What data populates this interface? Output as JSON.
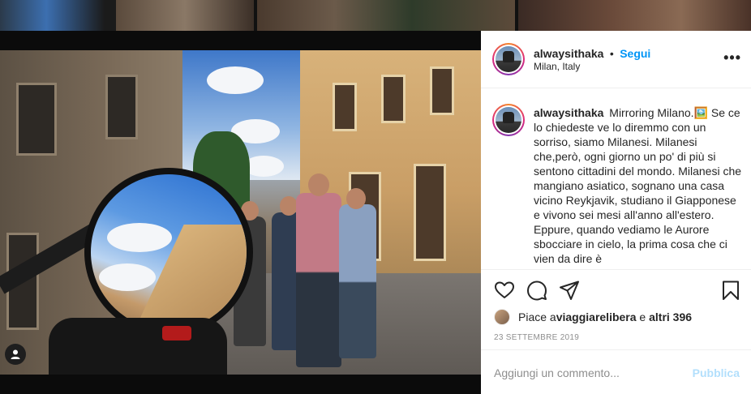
{
  "post": {
    "username": "alwaysithaka",
    "separator": "•",
    "follow_label": "Segui",
    "location": "Milan, Italy",
    "more_label": "•••",
    "caption_username": "alwaysithaka",
    "caption_text": "Mirroring Milano.🖼️ Se ce lo chiedeste ve lo diremmo con un sorriso, siamo Milanesi. Milanesi che,però, ogni giorno un po' di più si sentono cittadini del mondo. Milanesi che mangiano asiatico, sognano una casa vicino Reykjavik, studiano il Giapponese e vivono sei mesi all'anno all'estero. Eppure, quando vediamo le Aurore sbocciare in cielo, la prima cosa che ci vien da dire è",
    "likes_prefix": "Piace a ",
    "likes_user": "viaggiarelibera",
    "likes_middle": " e ",
    "likes_others": "altri 396",
    "date": "23 SETTEMBRE 2019",
    "comment_placeholder": "Aggiungi un commento...",
    "publish_label": "Pubblica"
  },
  "icons": {
    "like": "heart-icon",
    "comment": "comment-icon",
    "share": "share-icon",
    "save": "bookmark-icon",
    "tagged_user": "user-icon"
  },
  "colors": {
    "follow_blue": "#0095f6",
    "publish_disabled": "#b2dffc",
    "text": "#262626",
    "muted": "#8e8e8e"
  }
}
